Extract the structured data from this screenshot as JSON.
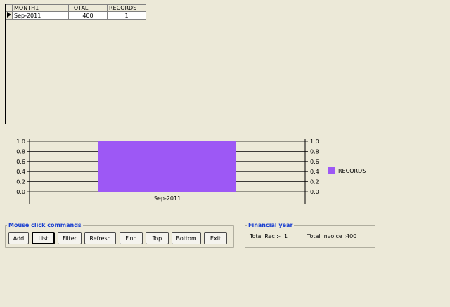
{
  "grid": {
    "columns": [
      "MONTH1",
      "TOTAL",
      "RECORDS"
    ],
    "rows": [
      {
        "month": "Sep-2011",
        "total": "400",
        "records": "1"
      }
    ]
  },
  "chart_data": {
    "type": "bar",
    "categories": [
      "Sep-2011"
    ],
    "series": [
      {
        "name": "RECORDS",
        "values": [
          1
        ],
        "color": "#9d58f5"
      }
    ],
    "ylim": [
      0,
      1
    ],
    "yticks": [
      "1.0",
      "0.8",
      "0.6",
      "0.4",
      "0.2",
      "0.0"
    ],
    "grid": true,
    "legend": "right"
  },
  "commands": {
    "legend": "Mouse click commands",
    "buttons": [
      "Add",
      "List",
      "Filter",
      "Refresh",
      "Find",
      "Top",
      "Bottom",
      "Exit"
    ]
  },
  "financial": {
    "legend": "Financial year",
    "total_rec_label": "Total Rec :-",
    "total_rec_value": "1",
    "total_invoice_label": "Total Invoice :-",
    "total_invoice_value": "400"
  }
}
